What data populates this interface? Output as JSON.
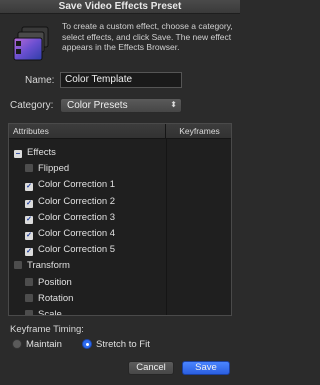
{
  "window": {
    "title": "Save Video Effects Preset"
  },
  "intro_text": "To create a custom effect, choose a category, select effects, and click Save. The new effect appears in the Effects Browser.",
  "name_field": {
    "label": "Name:",
    "value": "Color Template"
  },
  "category": {
    "label": "Category:",
    "value": "Color Presets"
  },
  "table": {
    "header_attributes": "Attributes",
    "header_keyframes": "Keyframes",
    "rows": [
      {
        "label": "Effects",
        "state": "mixed",
        "indent": 0
      },
      {
        "label": "Flipped",
        "state": "off",
        "indent": 1
      },
      {
        "label": "Color Correction 1",
        "state": "on",
        "indent": 1
      },
      {
        "label": "Color Correction 2",
        "state": "on",
        "indent": 1
      },
      {
        "label": "Color Correction 3",
        "state": "on",
        "indent": 1
      },
      {
        "label": "Color Correction 4",
        "state": "on",
        "indent": 1
      },
      {
        "label": "Color Correction 5",
        "state": "on",
        "indent": 1
      },
      {
        "label": "Transform",
        "state": "off",
        "indent": 0
      },
      {
        "label": "Position",
        "state": "off",
        "indent": 1
      },
      {
        "label": "Rotation",
        "state": "off",
        "indent": 1
      },
      {
        "label": "Scale",
        "state": "off",
        "indent": 1
      }
    ]
  },
  "keyframe_timing": {
    "label": "Keyframe Timing:",
    "options": [
      {
        "label": "Maintain",
        "selected": false
      },
      {
        "label": "Stretch to Fit",
        "selected": true
      }
    ]
  },
  "buttons": {
    "cancel": "Cancel",
    "save": "Save"
  },
  "colors": {
    "accent": "#2e6cf0",
    "background": "#2b2b2b"
  }
}
